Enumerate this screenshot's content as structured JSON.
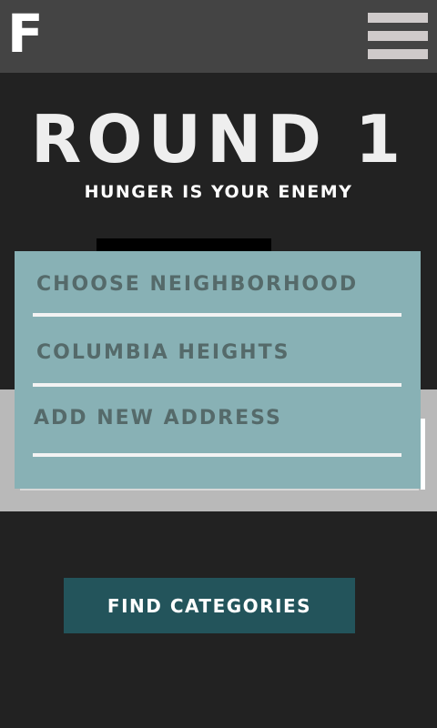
{
  "header": {
    "logo": "F",
    "menu_icon": "hamburger-menu-icon"
  },
  "hero": {
    "title": "ROUND 1",
    "subtitle": "HUNGER IS YOUR ENEMY"
  },
  "dropdown": {
    "items": [
      {
        "label": "CHOOSE NEIGHBORHOOD"
      },
      {
        "label": "COLUMBIA HEIGHTS"
      },
      {
        "label": "ADD NEW ADDRESS"
      }
    ]
  },
  "actions": {
    "find_label": "FIND CATEGORIES"
  },
  "colors": {
    "background": "#222222",
    "header": "#444444",
    "dropdown": "#88b1b5",
    "dropdown_text": "#556a6a",
    "button": "#23545b"
  }
}
